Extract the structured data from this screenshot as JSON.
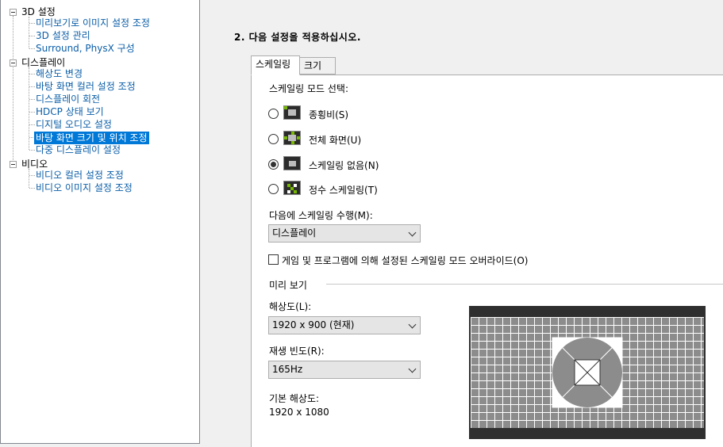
{
  "tree": {
    "categories": [
      {
        "label": "3D 설정",
        "items": [
          "미리보기로 이미지 설정 조정",
          "3D 설정 관리",
          "Surround, PhysX 구성"
        ]
      },
      {
        "label": "디스플레이",
        "items": [
          "해상도 변경",
          "바탕 화면 컬러 설정 조정",
          "디스플레이 회전",
          "HDCP 상태 보기",
          "디지털 오디오 설정",
          "바탕 화면 크기 및 위치 조정",
          "다중 디스플레이 설정"
        ]
      },
      {
        "label": "비디오",
        "items": [
          "비디오 컬러 설정 조정",
          "비디오 이미지 설정 조정"
        ]
      }
    ],
    "selected": "바탕 화면 크기 및 위치 조정"
  },
  "main": {
    "step_title": "2. 다음 설정을 적용하십시오.",
    "tabs": [
      {
        "label": "스케일링",
        "active": true
      },
      {
        "label": "크기",
        "active": false
      }
    ],
    "scaling_mode_label": "스케일링 모드 선택:",
    "modes": [
      {
        "label": "종횡비(S)",
        "checked": false,
        "icon": "aspect-ratio-icon"
      },
      {
        "label": "전체 화면(U)",
        "checked": false,
        "icon": "full-screen-icon"
      },
      {
        "label": "스케일링 없음(N)",
        "checked": true,
        "icon": "no-scaling-icon"
      },
      {
        "label": "정수 스케일링(T)",
        "checked": false,
        "icon": "integer-scaling-icon"
      }
    ],
    "perform_on_label": "다음에 스케일링 수행(M):",
    "perform_on_value": "디스플레이",
    "override_label": "게임 및 프로그램에 의해 설정된 스케일링 모드 오버라이드(O)",
    "override_checked": false,
    "preview_group": "미리 보기",
    "resolution_label": "해상도(L):",
    "resolution_value": "1920 x 900 (현재)",
    "refresh_label": "재생 빈도(R):",
    "refresh_value": "165Hz",
    "native_label": "기본 해상도:",
    "native_value": "1920 x 1080"
  },
  "colors": {
    "link": "#0b5ea8",
    "selection": "#0078d7",
    "nvidia_green": "#76b900"
  }
}
